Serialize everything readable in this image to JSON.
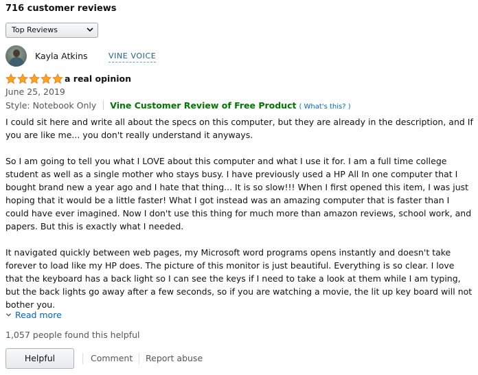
{
  "reviews_header": {
    "count_label": "716 customer reviews"
  },
  "sort": {
    "selected": "Top Reviews",
    "icon": "chevron-down-icon"
  },
  "reviewer": {
    "name": "Kayla Atkins",
    "badge": "VINE VOICE",
    "avatar_icon": "avatar"
  },
  "review": {
    "rating": 5,
    "rating_max": 5,
    "star_color": "#ffa41c",
    "title": "a real opinion",
    "date": "June 25, 2019",
    "style": "Style: Notebook Only",
    "vine_label": "Vine Customer Review of Free Product",
    "vine_label_color": "#007600",
    "whats_this": "( What's this? )",
    "body": [
      "I could sit here and write all about the specs on this computer, but they are already in the description, and If you are like me... you don't really understand it anyways.",
      "So I am going to tell you what I LOVE about this computer and what I use it for. I am a full time college student as well as a single mother who stays busy. I have previously used a HP All In one computer that I bought brand new a year ago and I hate that thing... It is so slow!!! When I first opened this item, I was just hoping that it would be a little faster! What I got instead was an amazing computer that is faster than I could have ever imagined. Now I don't use this thing for much more than amazon reviews, school work, and papers. But this is exactly what I needed.",
      "It navigated quickly between web pages, my Microsoft word programs opens instantly and doesn't take forever to load like my HP does. The picture of this monitor is just beautiful. Everything is so clear. I love that the keyboard has a back light so I can see the keys if I need to take a look at them while I am typing, but the back lights go away after a few seconds, so if you are watching a movie, the lit up key board will not bother you."
    ],
    "read_more": "Read more",
    "helpful_count": "1,057 people found this helpful"
  },
  "actions": {
    "helpful": "Helpful",
    "comment": "Comment",
    "report": "Report abuse"
  },
  "colors": {
    "link": "#0066c0",
    "muted": "#555555"
  }
}
